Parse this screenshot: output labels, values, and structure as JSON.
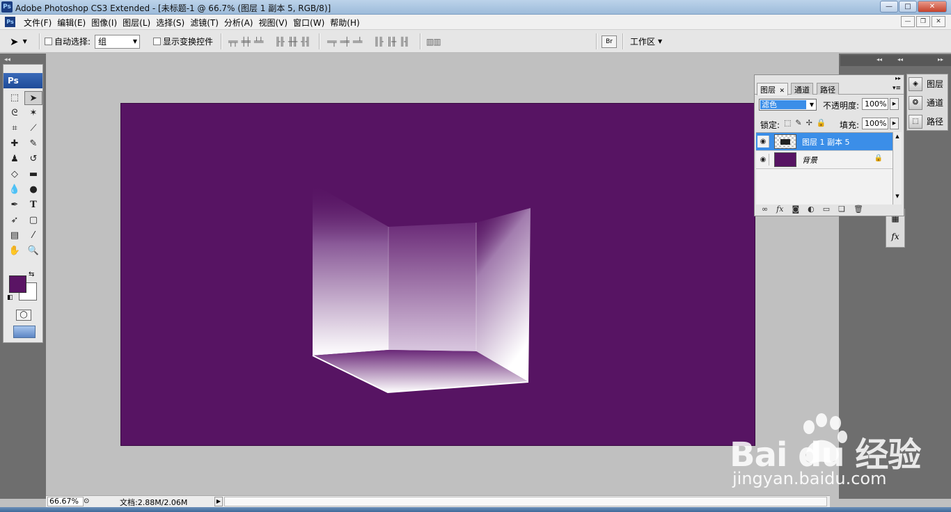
{
  "window": {
    "title": "Adobe Photoshop CS3 Extended - [未标题-1 @ 66.7% (图层 1 副本 5, RGB/8)]",
    "app_icon": "Ps",
    "minimize_label": "—",
    "maximize_label": "□",
    "close_label": "✕"
  },
  "menu": {
    "items": [
      "文件(F)",
      "编辑(E)",
      "图像(I)",
      "图层(L)",
      "选择(S)",
      "滤镜(T)",
      "分析(A)",
      "视图(V)",
      "窗口(W)",
      "帮助(H)"
    ]
  },
  "options": {
    "auto_select_label": "自动选择:",
    "auto_select_value": "组",
    "show_transform_label": "显示变换控件",
    "workspace_label": "工作区"
  },
  "toolbox": {
    "header": "Ps",
    "foreground_color": "#5a1464",
    "background_color": "#ffffff"
  },
  "canvas": {
    "background_color": "#571463"
  },
  "status": {
    "zoom": "66.67%",
    "doc_info": "文档:2.88M/2.06M"
  },
  "dock": {
    "items": [
      {
        "label": "图层",
        "icon": "layers-icon"
      },
      {
        "label": "通道",
        "icon": "channels-icon"
      },
      {
        "label": "路径",
        "icon": "paths-icon"
      }
    ]
  },
  "layers_panel": {
    "tabs": [
      "图层",
      "通道",
      "路径"
    ],
    "blend_mode": "滤色",
    "opacity_label": "不透明度:",
    "opacity_value": "100%",
    "lock_label": "锁定:",
    "fill_label": "填充:",
    "fill_value": "100%",
    "layers": [
      {
        "name": "图层 1 副本 5",
        "selected": true,
        "thumb": "checker"
      },
      {
        "name": "背景",
        "selected": false,
        "thumb": "purple",
        "locked": true
      }
    ]
  },
  "watermark": {
    "logo_text": "Bai du 经验",
    "url": "jingyan.baidu.com"
  }
}
